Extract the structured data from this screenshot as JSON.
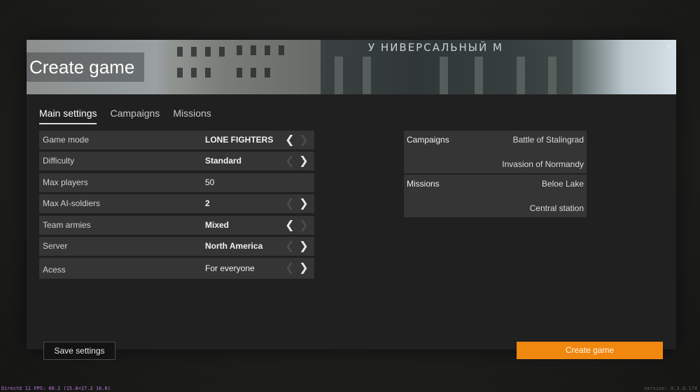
{
  "window": {
    "title": "Create game",
    "banner_sign": "У НИВЕРСАЛЬНЫЙ М"
  },
  "tabs": [
    {
      "label": "Main settings",
      "active": true
    },
    {
      "label": "Campaigns",
      "active": false
    },
    {
      "label": "Missions",
      "active": false
    }
  ],
  "settings": [
    {
      "label": "Game mode",
      "value": "LONE FIGHTERS",
      "left_enabled": true,
      "right_enabled": false
    },
    {
      "label": "Difficulty",
      "value": "Standard",
      "left_enabled": false,
      "right_enabled": true
    },
    {
      "label": "Max players",
      "value": "50"
    },
    {
      "label": "Max AI-soldiers",
      "value": "2",
      "left_enabled": false,
      "right_enabled": true
    },
    {
      "label": "Team armies",
      "value": "Mixed",
      "left_enabled": true,
      "right_enabled": false
    },
    {
      "label": "Server",
      "value": "North America",
      "left_enabled": false,
      "right_enabled": true
    },
    {
      "label": "Acess",
      "value": "For everyone",
      "left_enabled": false,
      "right_enabled": true
    }
  ],
  "summary": {
    "campaigns_label": "Campaigns",
    "campaigns": [
      "Battle of Stalingrad",
      "Invasion of Normandy"
    ],
    "missions_label": "Missions",
    "missions": [
      "Beloe Lake",
      "Central station"
    ]
  },
  "buttons": {
    "save": "Save settings",
    "create": "Create game"
  },
  "footer": {
    "fps": "DirectX 11 FPS: 60.1 (15.8<17.2 16.6)",
    "version": "version: 0.3.0.174"
  },
  "colors": {
    "accent": "#f0870f",
    "row_bg": "#343534",
    "panel_bg": "#1f201f"
  },
  "icons": {
    "close": "close-icon",
    "arrow_left": "chevron-left-icon",
    "arrow_right": "chevron-right-icon"
  }
}
